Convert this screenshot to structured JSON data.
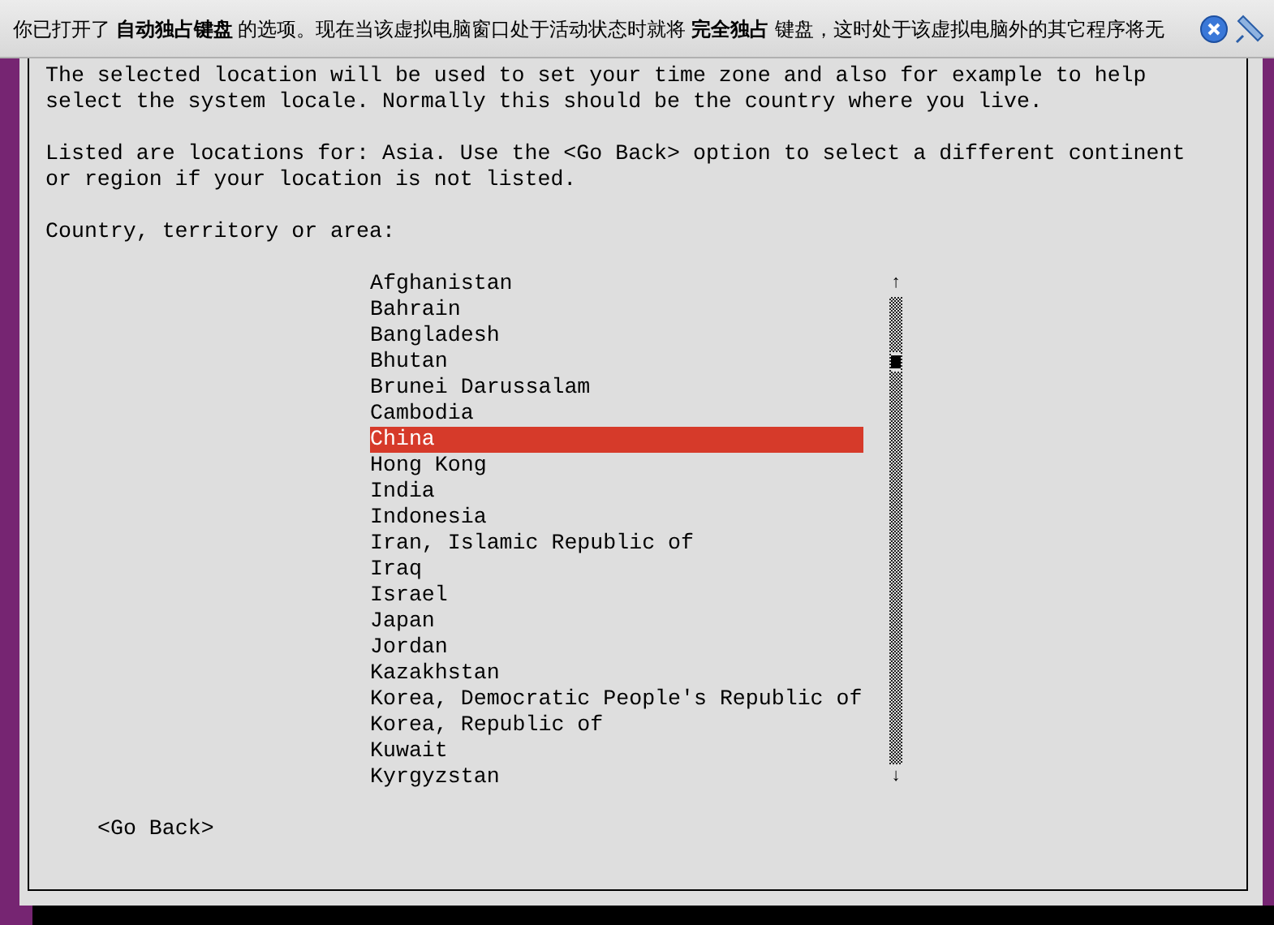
{
  "notification": {
    "message": "你已打开了 **自动独占键盘** 的选项。现在当该虚拟电脑窗口处于活动状态时就将 **完全独占** 键盘，这时处于该虚拟电脑外的其它程序将无"
  },
  "dialog": {
    "paragraphs": [
      "The selected location will be used to set your time zone and also for example to help select the system locale. Normally this should be the country where you live.",
      "Listed are locations for: Asia. Use the <Go Back> option to select a different continent or region if your location is not listed."
    ],
    "prompt": "Country, territory or area:",
    "list": [
      {
        "label": "Afghanistan",
        "selected": false
      },
      {
        "label": "Bahrain",
        "selected": false
      },
      {
        "label": "Bangladesh",
        "selected": false
      },
      {
        "label": "Bhutan",
        "selected": false
      },
      {
        "label": "Brunei Darussalam",
        "selected": false
      },
      {
        "label": "Cambodia",
        "selected": false
      },
      {
        "label": "China",
        "selected": true
      },
      {
        "label": "Hong Kong",
        "selected": false
      },
      {
        "label": "India",
        "selected": false
      },
      {
        "label": "Indonesia",
        "selected": false
      },
      {
        "label": "Iran, Islamic Republic of",
        "selected": false
      },
      {
        "label": "Iraq",
        "selected": false
      },
      {
        "label": "Israel",
        "selected": false
      },
      {
        "label": "Japan",
        "selected": false
      },
      {
        "label": "Jordan",
        "selected": false
      },
      {
        "label": "Kazakhstan",
        "selected": false
      },
      {
        "label": "Korea, Democratic People's Republic of",
        "selected": false
      },
      {
        "label": "Korea, Republic of",
        "selected": false
      },
      {
        "label": "Kuwait",
        "selected": false
      },
      {
        "label": "Kyrgyzstan",
        "selected": false
      }
    ],
    "scroll_up": "↑",
    "scroll_down": "↓",
    "back_button": "<Go Back>"
  }
}
